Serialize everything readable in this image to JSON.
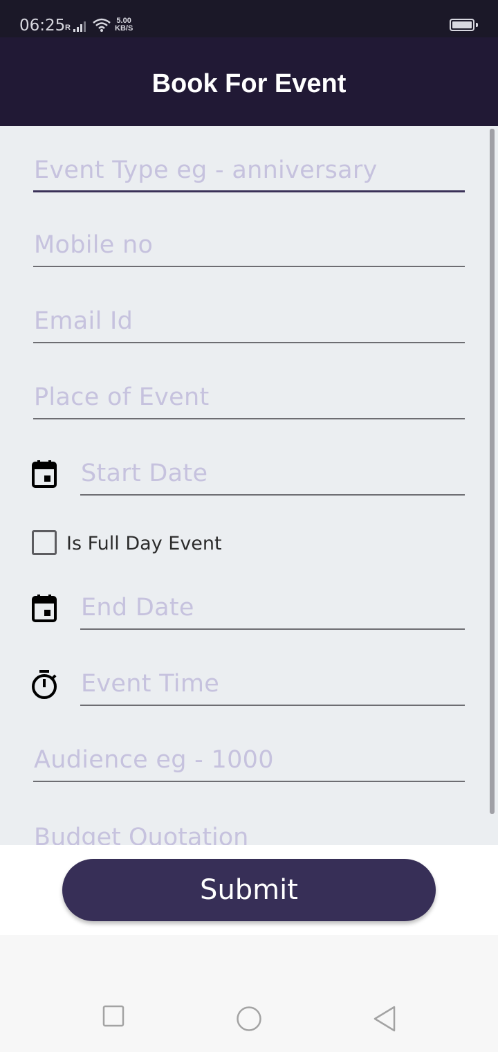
{
  "status_bar": {
    "time": "06:25",
    "roaming": "R",
    "speed_value": "5.00",
    "speed_unit": "KB/S"
  },
  "app_bar": {
    "title": "Book For Event"
  },
  "form": {
    "event_type": {
      "placeholder": "Event Type eg - anniversary",
      "value": ""
    },
    "mobile": {
      "placeholder": "Mobile no",
      "value": ""
    },
    "email": {
      "placeholder": "Email Id",
      "value": ""
    },
    "place": {
      "placeholder": "Place of Event",
      "value": ""
    },
    "start_date": {
      "placeholder": "Start Date",
      "icon": "calendar-icon",
      "value": ""
    },
    "full_day": {
      "label": "Is Full Day Event",
      "checked": false
    },
    "end_date": {
      "placeholder": "End Date",
      "icon": "calendar-icon",
      "value": ""
    },
    "event_time": {
      "placeholder": "Event Time",
      "icon": "timer-icon",
      "value": ""
    },
    "audience": {
      "placeholder": "Audience eg - 1000",
      "value": ""
    },
    "budget": {
      "placeholder": "Budget Quotation",
      "value": ""
    }
  },
  "submit": {
    "label": "Submit"
  },
  "nav": {
    "recents": "square-icon",
    "home": "circle-icon",
    "back": "triangle-back-icon"
  },
  "colors": {
    "status_bar": "#1b1828",
    "app_bar": "#211935",
    "form_bg": "#ebeef1",
    "placeholder": "#c6c2de",
    "submit": "#372f57"
  }
}
